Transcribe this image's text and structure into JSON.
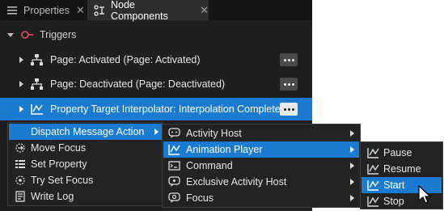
{
  "tabs": [
    {
      "label": "Properties",
      "icon": "properties-icon",
      "active": false
    },
    {
      "label": "Node Components",
      "icon": "node-components-icon",
      "active": true
    }
  ],
  "section": {
    "label": "Triggers",
    "icon": "triggers-icon"
  },
  "rows": [
    {
      "label": "Page: Activated (Page: Activated)",
      "icon": "trigger-hierarchy-icon",
      "selected": false
    },
    {
      "label": "Page: Deactivated (Page: Deactivated)",
      "icon": "trigger-hierarchy-icon",
      "selected": false
    },
    {
      "label": "Property Target Interpolator: Interpolation Completed",
      "icon": "interpolator-icon",
      "selected": true
    }
  ],
  "menu1": [
    {
      "label": "Dispatch Message Action",
      "icon": "",
      "submenu": true,
      "highlighted": true
    },
    {
      "label": "Move Focus",
      "icon": "move-focus-icon",
      "submenu": false
    },
    {
      "label": "Set Property",
      "icon": "set-property-icon",
      "submenu": false
    },
    {
      "label": "Try Set Focus",
      "icon": "try-set-focus-icon",
      "submenu": false
    },
    {
      "label": "Write Log",
      "icon": "write-log-icon",
      "submenu": false
    }
  ],
  "menu2": [
    {
      "label": "Activity Host",
      "icon": "activity-host-icon",
      "submenu": true
    },
    {
      "label": "Animation Player",
      "icon": "animation-player-icon",
      "submenu": true,
      "highlighted": true
    },
    {
      "label": "Command",
      "icon": "command-icon",
      "submenu": true
    },
    {
      "label": "Exclusive Activity Host",
      "icon": "exclusive-activity-host-icon",
      "submenu": true
    },
    {
      "label": "Focus",
      "icon": "focus-icon",
      "submenu": true
    }
  ],
  "menu3": [
    {
      "label": "Pause",
      "icon": "animation-icon"
    },
    {
      "label": "Resume",
      "icon": "animation-icon"
    },
    {
      "label": "Start",
      "icon": "animation-icon",
      "highlighted": true
    },
    {
      "label": "Stop",
      "icon": "animation-icon"
    }
  ],
  "colors": {
    "accent": "#1a7bd0",
    "panel": "#1f1f1f",
    "menu": "#232323"
  }
}
